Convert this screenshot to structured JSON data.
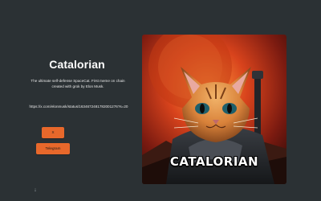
{
  "hero": {
    "title": "Catalorian",
    "description": "The ultimate self-defense SpaceCat. First meme on chain created with grok by Elon Musk.",
    "link": "https://x.com/elonmusk/status/1634672481782001276?s=20",
    "buttons": {
      "x_label": "X",
      "telegram_label": "Telegram"
    },
    "scroll_icon": "arrow-down-icon",
    "art": {
      "label": "CATALORIAN",
      "alt": "cat in space armor"
    }
  },
  "colors": {
    "background": "#2b3134",
    "button": "#e8682b",
    "text": "#ffffff"
  }
}
